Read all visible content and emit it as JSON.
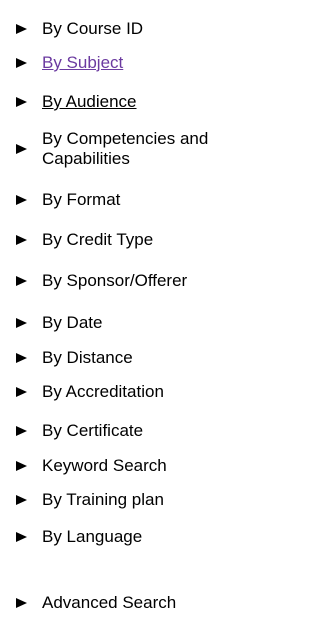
{
  "menu": {
    "items": [
      {
        "label": "By Course ID"
      },
      {
        "label": "By Subject"
      },
      {
        "label": "By Audience"
      },
      {
        "label": "By Competencies and Capabilities"
      },
      {
        "label": "By Format"
      },
      {
        "label": "By Credit Type"
      },
      {
        "label": "By Sponsor/Offerer"
      },
      {
        "label": "By Date"
      },
      {
        "label": "By Distance"
      },
      {
        "label": "By Accreditation"
      },
      {
        "label": "By Certificate"
      },
      {
        "label": "Keyword Search"
      },
      {
        "label": "By Training plan"
      },
      {
        "label": "By Language"
      },
      {
        "label": "Advanced Search"
      }
    ]
  }
}
